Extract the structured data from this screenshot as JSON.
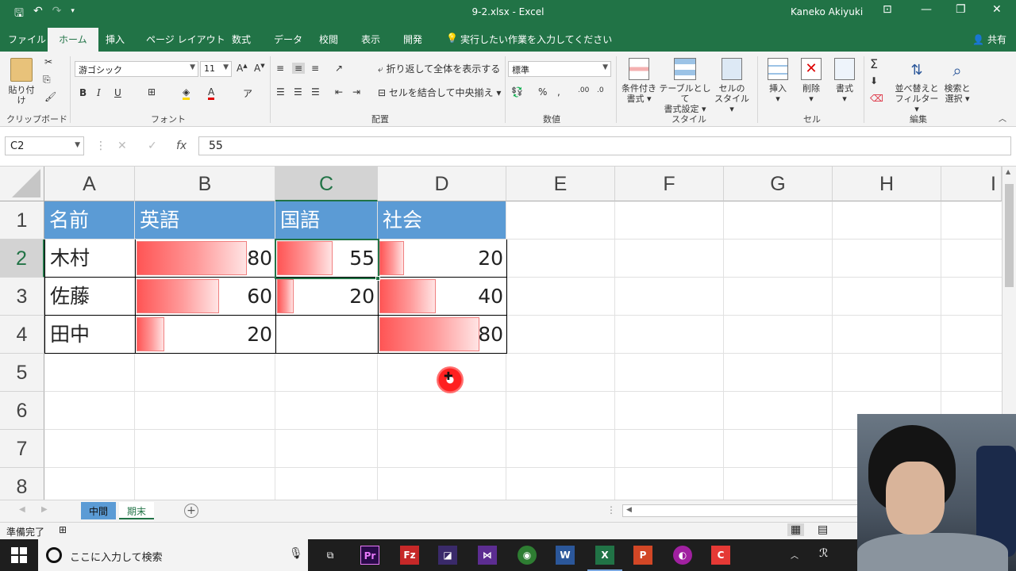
{
  "window": {
    "title": "9-2.xlsx  -  Excel",
    "user": "Kaneko Akiyuki",
    "accent": "#217346"
  },
  "ribbon_tabs": [
    "ファイル",
    "ホーム",
    "挿入",
    "ページ レイアウト",
    "数式",
    "データ",
    "校閲",
    "表示",
    "開発"
  ],
  "tell_me": "実行したい作業を入力してください",
  "share_label": "共有",
  "ribbon": {
    "paste": "貼り付け",
    "clipboard": "クリップボード",
    "font_name": "游ゴシック",
    "font_size": "11",
    "font_group": "フォント",
    "wrap_text": "折り返して全体を表示する",
    "merge_center": "セルを結合して中央揃え",
    "alignment_group": "配置",
    "number_format": "標準",
    "number_group": "数値",
    "cond_format_1": "条件付き",
    "cond_format_2": "書式",
    "table_format_1": "テーブルとして",
    "table_format_2": "書式設定",
    "cell_style_1": "セルの",
    "cell_style_2": "スタイル",
    "styles_group": "スタイル",
    "insert": "挿入",
    "delete": "削除",
    "format": "書式",
    "cells_group": "セル",
    "sort_filter_1": "並べ替えと",
    "sort_filter_2": "フィルター",
    "find_select_1": "検索と",
    "find_select_2": "選択",
    "editing_group": "編集"
  },
  "formula_bar": {
    "name_box": "C2",
    "fx": "fx",
    "value": "55"
  },
  "columns": [
    "A",
    "B",
    "C",
    "D",
    "E",
    "F",
    "G",
    "H",
    "I"
  ],
  "rows": [
    "1",
    "2",
    "3",
    "4",
    "5",
    "6",
    "7",
    "8"
  ],
  "table": {
    "header_color": "#5b9bd5",
    "headers": [
      "名前",
      "英語",
      "国語",
      "社会"
    ],
    "names": [
      "木村",
      "佐藤",
      "田中"
    ],
    "english": [
      "80",
      "60",
      "20"
    ],
    "japanese": [
      "55",
      "20",
      ""
    ],
    "social": [
      "20",
      "40",
      "80"
    ],
    "databar_fraction": {
      "english": [
        1.0,
        0.75,
        0.25
      ],
      "japanese": [
        0.5,
        0.15,
        0
      ],
      "social": [
        0.2,
        0.45,
        0.8
      ]
    }
  },
  "sheets": [
    "中間",
    "期末"
  ],
  "status": {
    "ready": "準備完了"
  },
  "taskbar": {
    "search_placeholder": "ここに入力して検索"
  }
}
